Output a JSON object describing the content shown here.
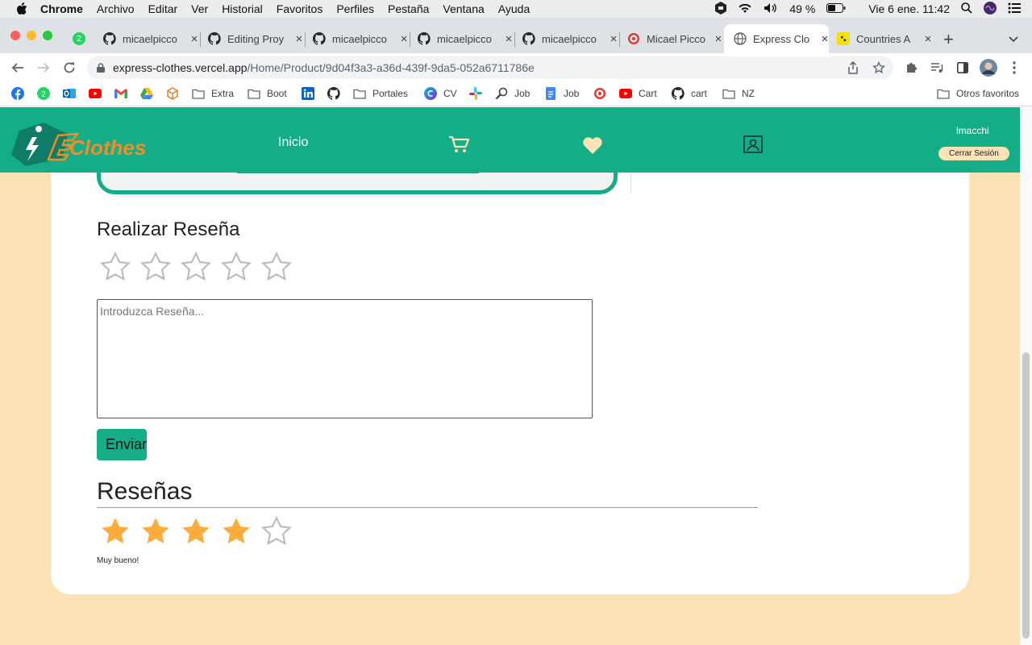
{
  "menubar": {
    "app": "Chrome",
    "items": [
      "Archivo",
      "Editar",
      "Ver",
      "Historial",
      "Favoritos",
      "Perfiles",
      "Pestaña",
      "Ventana",
      "Ayuda"
    ],
    "battery": "49 %",
    "datetime": "Vie 6 ene.  11:42"
  },
  "tabs": [
    {
      "title": "micaelpicco",
      "icon": "github-icon"
    },
    {
      "title": "Editing Proy",
      "icon": "github-icon"
    },
    {
      "title": "micaelpicco",
      "icon": "github-icon"
    },
    {
      "title": "micaelpicco",
      "icon": "github-icon"
    },
    {
      "title": "micaelpicco",
      "icon": "github-icon"
    },
    {
      "title": "Micael Picco",
      "icon": "target-icon"
    },
    {
      "title": "Express Clo",
      "icon": "globe-icon",
      "active": true
    },
    {
      "title": "Countries A",
      "icon": "app-icon"
    }
  ],
  "whatsapp_badge": "2",
  "address": {
    "host": "express-clothes.vercel.app",
    "path": "/Home/Product/9d04f3a3-a36d-439f-9da5-052a6711786e"
  },
  "bookmarks": [
    {
      "label": "",
      "icon": "facebook-icon"
    },
    {
      "label": "",
      "icon": "whatsapp-icon"
    },
    {
      "label": "",
      "icon": "outlook-icon"
    },
    {
      "label": "",
      "icon": "youtube-icon"
    },
    {
      "label": "",
      "icon": "gmail-icon"
    },
    {
      "label": "",
      "icon": "drive-icon"
    },
    {
      "label": "",
      "icon": "cube-icon"
    },
    {
      "label": "Extra",
      "icon": "folder-icon"
    },
    {
      "label": "Boot",
      "icon": "folder-icon"
    },
    {
      "label": "",
      "icon": "linkedin-icon"
    },
    {
      "label": "",
      "icon": "github-icon"
    },
    {
      "label": "Portales",
      "icon": "folder-icon"
    },
    {
      "label": "CV",
      "icon": "canva-icon"
    },
    {
      "label": "",
      "icon": "slack-icon"
    },
    {
      "label": "Job",
      "icon": "search-icon"
    },
    {
      "label": "Job",
      "icon": "docs-icon"
    },
    {
      "label": "",
      "icon": "target-icon"
    },
    {
      "label": "Cart",
      "icon": "youtube-icon"
    },
    {
      "label": "cart",
      "icon": "github-icon"
    },
    {
      "label": "NZ",
      "icon": "folder-icon"
    }
  ],
  "other_bookmarks": "Otros favoritos",
  "site": {
    "logo_text": "Clothes",
    "nav_home": "Inicio",
    "username": "lmacchi",
    "logout": "Cerrar Sesión"
  },
  "review_form": {
    "title": "Realizar Reseña",
    "rating": 0,
    "max_rating": 5,
    "placeholder": "Introduzca Reseña...",
    "submit": "Enviar"
  },
  "reviews": {
    "title": "Reseñas",
    "items": [
      {
        "rating": 4,
        "max_rating": 5,
        "text": "Muy bueno!"
      }
    ]
  },
  "colors": {
    "brand": "#13ae88",
    "page_bg": "#fde2b6",
    "star_filled": "#fdab3a",
    "star_empty": "#bbbbbb",
    "logo_accent": "#f28c28"
  }
}
